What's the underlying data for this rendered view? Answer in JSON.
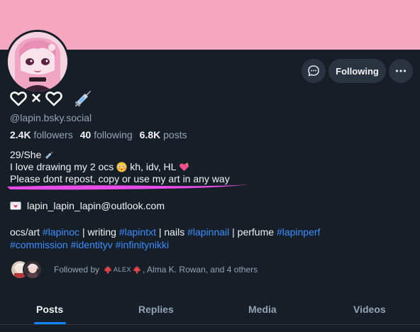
{
  "profile": {
    "handle": "@lapin.bsky.social",
    "display_name_separator": "×"
  },
  "stats": {
    "followers_count": "2.4K",
    "followers_label": "followers",
    "following_count": "40",
    "following_label": "following",
    "posts_count": "6.8K",
    "posts_label": "posts"
  },
  "actions": {
    "follow_label": "Following"
  },
  "bio": {
    "line1": "29/She",
    "line2a": "I love drawing my 2 ocs",
    "line2b": "kh, idv, HL",
    "line3": "Please dont repost, copy or use my art in any way"
  },
  "contact": {
    "email": "lapin_lapin_lapin@outlook.com"
  },
  "tags_line": {
    "t1": "ocs/art ",
    "h1": "#lapinoc",
    "t2": " | writing ",
    "h2": "#lapintxt",
    "t3": " | nails ",
    "h3": "#lapinnail",
    "t4": " | perfume ",
    "h4": "#lapinperf",
    "h5": "#commission",
    "h6": "#identityv",
    "h7": "#infinitynikki"
  },
  "followed_by": {
    "prefix": "Followed by",
    "name1": "ALEX",
    "rest": ", Alma K. Rowan, and 4 others"
  },
  "tabs": [
    {
      "label": "Posts"
    },
    {
      "label": "Replies"
    },
    {
      "label": "Media"
    },
    {
      "label": "Videos"
    }
  ],
  "colors": {
    "banner": "#f4a7bf",
    "background": "#161e27",
    "link": "#3f8dff",
    "tab_active_underline": "#1083fe",
    "annotation_underline": "#e84ce8"
  }
}
